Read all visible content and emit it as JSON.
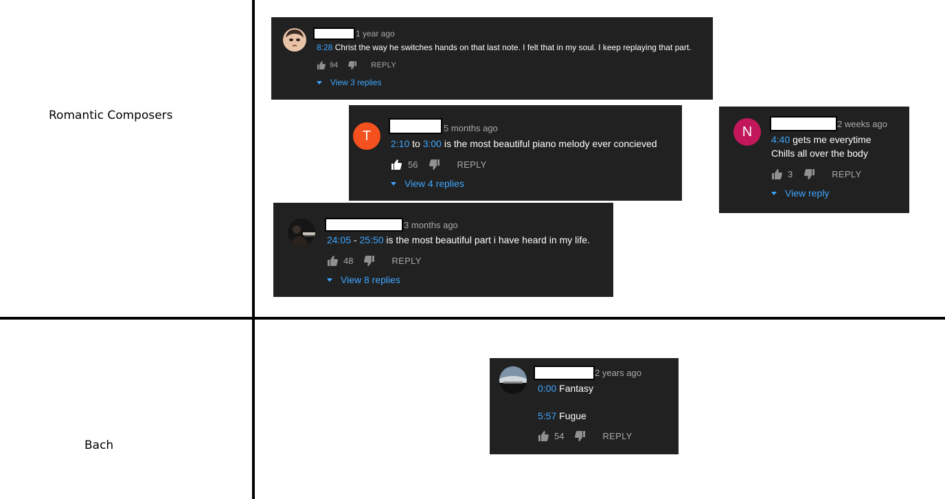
{
  "labels": {
    "top": "Romantic Composers",
    "bottom": "Bach"
  },
  "colors": {
    "card_bg": "#212121",
    "timestamp_link": "#3ea6ff",
    "muted": "#aaaaaa",
    "avatar_t": "#f4511e",
    "avatar_n": "#c2185b"
  },
  "comments": [
    {
      "ago": "1 year ago",
      "ts1": "8:28",
      "text": " Christ the way he switches hands on that last note. I felt that in my soul. I keep replaying that part.",
      "likes": "94",
      "reply": "REPLY",
      "view": "View 3 replies"
    },
    {
      "avatar_letter": "T",
      "ago": "5 months ago",
      "ts1": "2:10",
      "mid": " to ",
      "ts2": "3:00",
      "text": " is the most beautiful piano melody ever concieved",
      "likes": "56",
      "reply": "REPLY",
      "view": "View 4 replies"
    },
    {
      "avatar_letter": "N",
      "ago": "2 weeks ago",
      "ts1": "4:40",
      "text": " gets me everytime",
      "line2": "Chills all over the body",
      "likes": "3",
      "reply": "REPLY",
      "view": "View reply"
    },
    {
      "ago": "3 months ago",
      "ts1": "24:05",
      "mid": " - ",
      "ts2": "25:50",
      "text": " is the most beautiful part i have heard in my life.",
      "likes": "48",
      "reply": "REPLY",
      "view": "View 8 replies"
    },
    {
      "ago": "2 years ago",
      "ts1": "0:00",
      "text": " Fantasy",
      "ts2": "5:57",
      "text2": " Fugue",
      "likes": "54",
      "reply": "REPLY"
    }
  ]
}
